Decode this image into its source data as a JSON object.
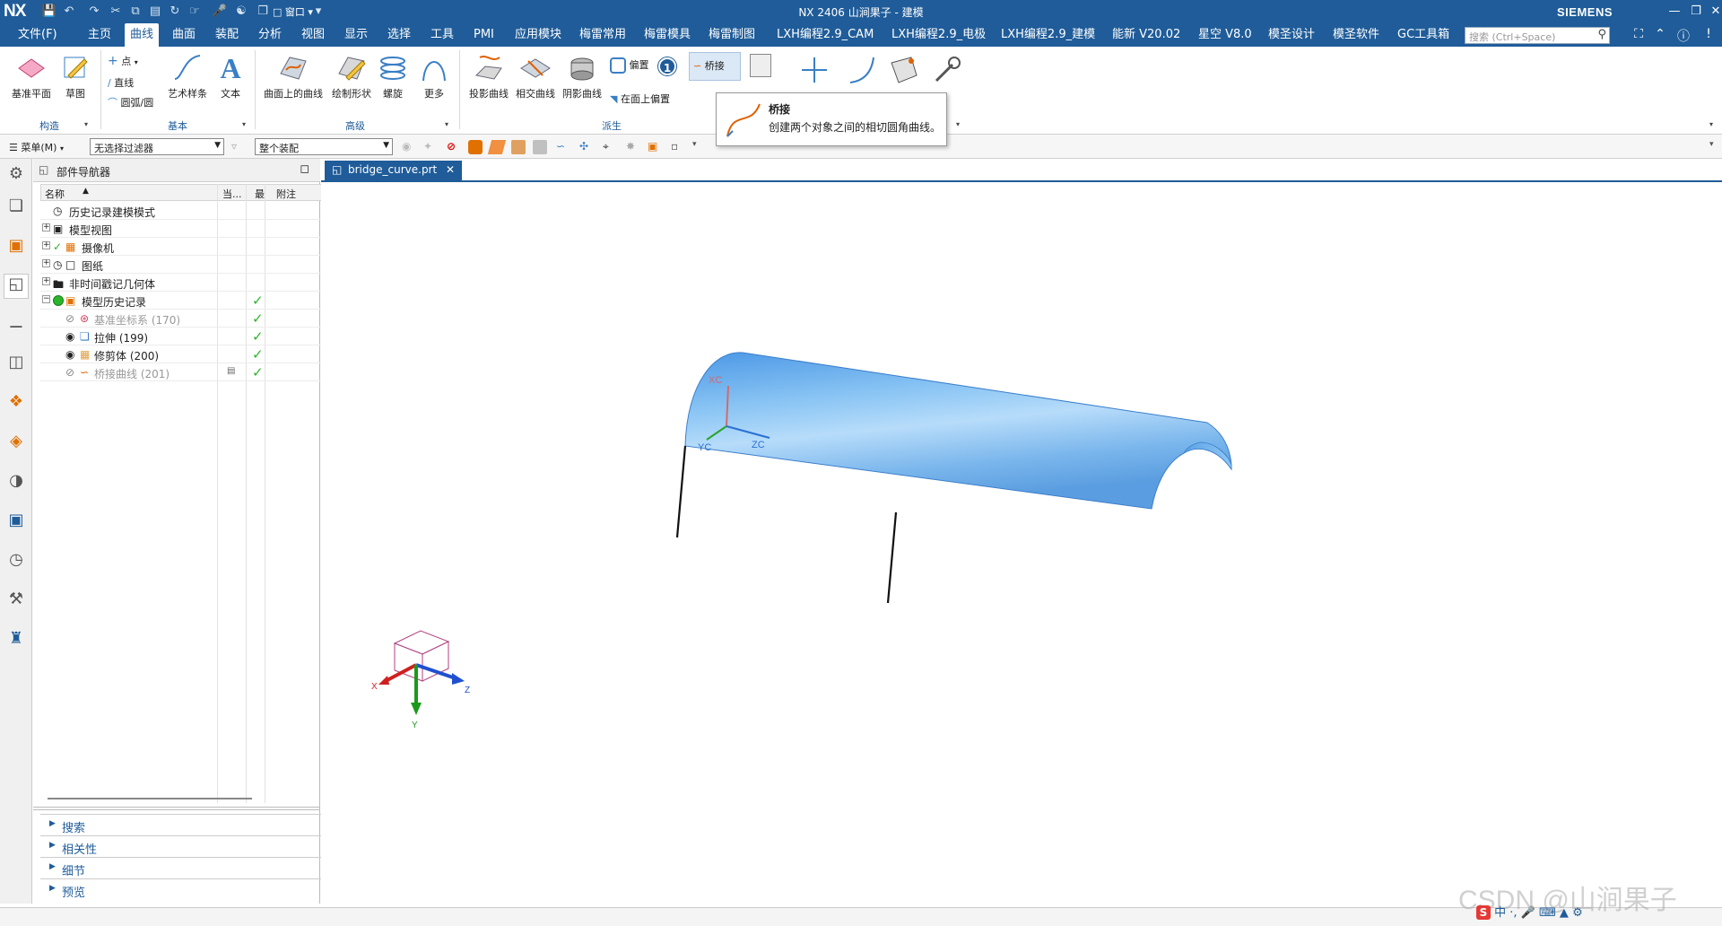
{
  "app": {
    "logo": "NX",
    "title": "NX 2406 山涧果子 - 建模",
    "brand": "SIEMENS",
    "quick_access_window": "窗口"
  },
  "menu": {
    "items": [
      "文件(F)",
      "主页",
      "曲线",
      "曲面",
      "装配",
      "分析",
      "视图",
      "显示",
      "选择",
      "工具",
      "PMI",
      "应用模块",
      "梅雷常用",
      "梅雷模具",
      "梅雷制图",
      "LXH编程2.9_CAM",
      "LXH编程2.9_电极",
      "LXH编程2.9_建模",
      "能新 V20.02",
      "星空 V8.0",
      "模圣设计",
      "模圣软件",
      "GC工具箱"
    ],
    "active": "曲线",
    "search_placeholder": "搜索 (Ctrl+Space)"
  },
  "ribbon": {
    "construct": {
      "group": "构造",
      "datum_plane": "基准平面",
      "sketch": "草图"
    },
    "basic": {
      "group": "基本",
      "point": "点",
      "line": "直线",
      "arc": "圆弧/圆",
      "art_spline": "艺术样条",
      "text": "文本"
    },
    "advanced": {
      "group": "高级",
      "curve_on_surface": "曲面上的曲线",
      "draw_shape": "绘制形状",
      "helix": "螺旋",
      "more": "更多"
    },
    "derived": {
      "group": "派生",
      "project_curve": "投影曲线",
      "intersect_curve": "相交曲线",
      "shadow_curve": "阴影曲线",
      "offset": "偏置",
      "offset_on_face": "在面上偏置",
      "bridge": "桥接",
      "badge_count": "1"
    },
    "tooltip": {
      "title": "桥接",
      "description": "创建两个对象之间的相切圆角曲线。"
    }
  },
  "selection_bar": {
    "menu_label": "菜单(M)",
    "filter": "无选择过滤器",
    "scope": "整个装配"
  },
  "navigator": {
    "title": "部件导航器",
    "columns": {
      "name": "名称",
      "current": "当...",
      "latest": "最",
      "note": "附注"
    },
    "rows": [
      {
        "label": "历史记录建模模式",
        "dim": false,
        "check": false
      },
      {
        "label": "模型视图",
        "dim": false,
        "check": false
      },
      {
        "label": "摄像机",
        "dim": false,
        "check": false
      },
      {
        "label": "图纸",
        "dim": false,
        "check": false
      },
      {
        "label": "非时间戳记几何体",
        "dim": false,
        "check": false
      },
      {
        "label": "模型历史记录",
        "dim": false,
        "check": true
      },
      {
        "label": "基准坐标系 (170)",
        "dim": true,
        "check": true
      },
      {
        "label": "拉伸 (199)",
        "dim": false,
        "check": true
      },
      {
        "label": "修剪体 (200)",
        "dim": false,
        "check": true
      },
      {
        "label": "桥接曲线 (201)",
        "dim": true,
        "check": true
      }
    ],
    "panels": [
      "搜索",
      "相关性",
      "细节",
      "预览"
    ]
  },
  "graphics": {
    "tab": "bridge_curve.prt",
    "wcs_labels": {
      "xc": "XC",
      "yc": "YC",
      "zc": "ZC"
    },
    "triad_labels": {
      "x": "X",
      "y": "Y",
      "z": "Z"
    }
  },
  "overlay": {
    "watermark": "CSDN @山涧果子",
    "ime": "中 ·,"
  },
  "colors": {
    "brand_blue": "#1f5c99",
    "surface_blue": "#7bbcf0",
    "check_green": "#2bb52b"
  }
}
